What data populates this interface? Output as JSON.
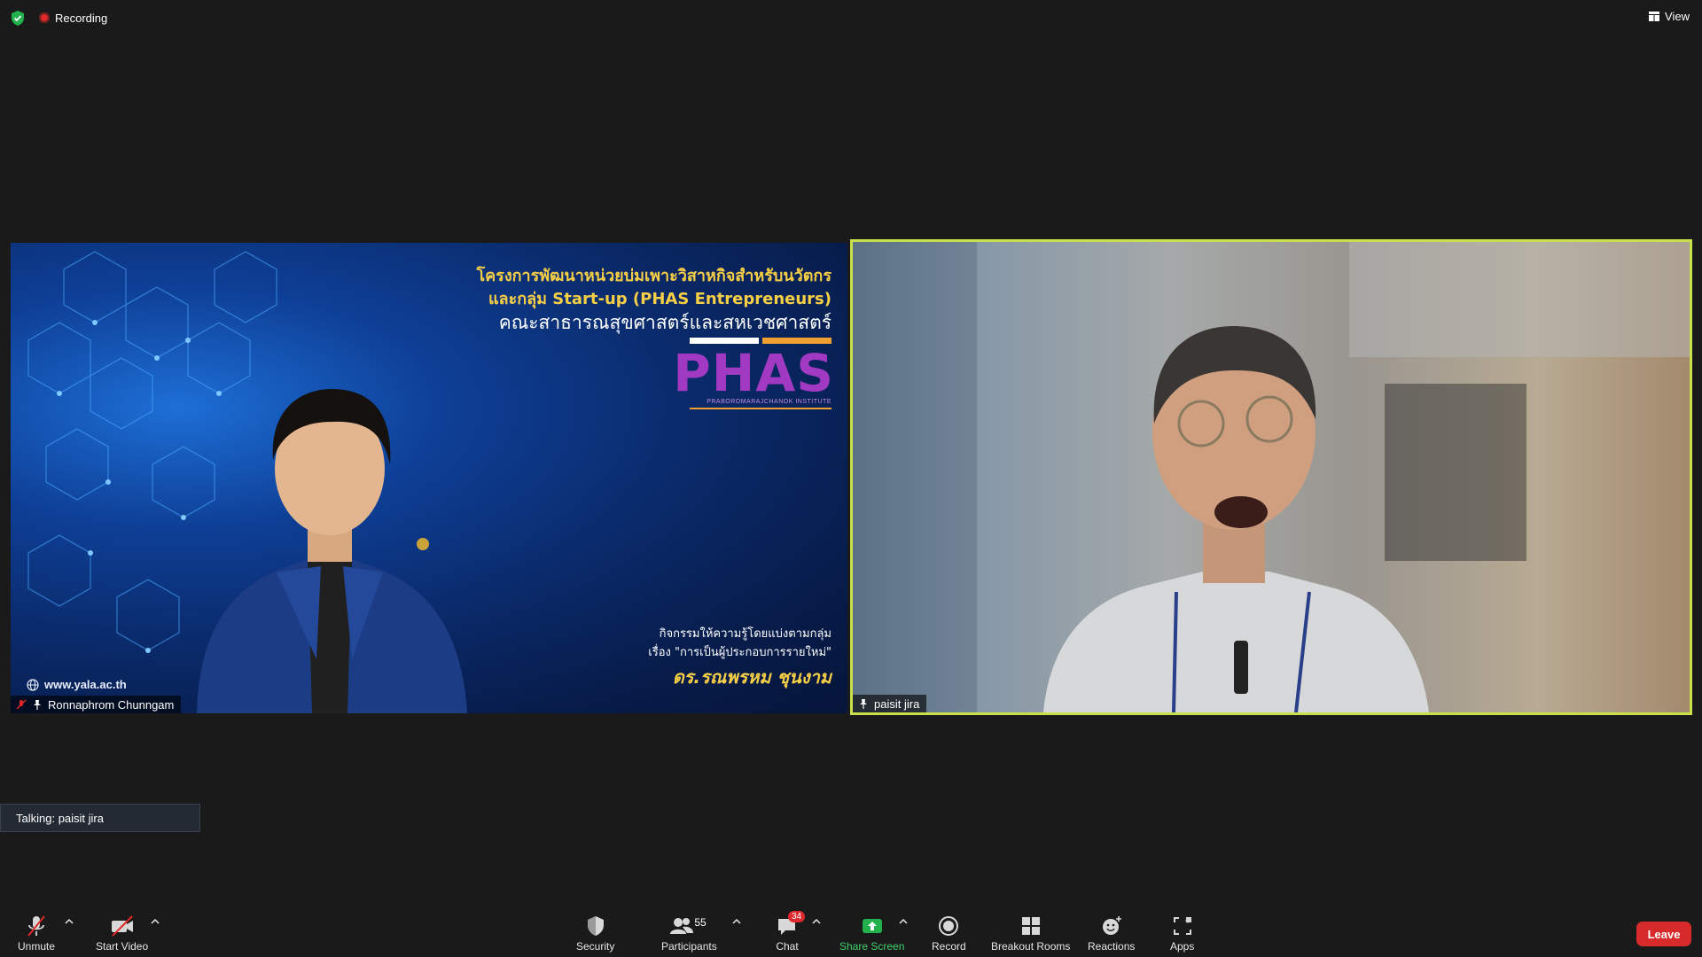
{
  "topbar": {
    "recording_label": "Recording",
    "view_label": "View"
  },
  "colors": {
    "active_speaker_border": "#c9e04a",
    "leave_button": "#d72b2b",
    "share_screen_green": "#22b14c",
    "recording_red": "#e02828"
  },
  "participants": [
    {
      "name": "Ronnaphrom Chunngam"
    },
    {
      "name": "paisit jira"
    }
  ],
  "slide": {
    "title_line1": "โครงการพัฒนาหน่วยบ่มเพาะวิสาหกิจสำหรับนวัตกร",
    "title_line2": "และกลุ่ม Start-up (PHAS Entrepreneurs)",
    "title_line3": "คณะสาธารณสุขศาสตร์และสหเวชศาสตร์",
    "logo": "PHAS",
    "logo_sub": "PRABOROMARAJCHANOK INSTITUTE",
    "activity_line1": "กิจกรรมให้ความรู้โดยแบ่งตามกลุ่ม",
    "activity_line2": "เรื่อง \"การเป็นผู้ประกอบการรายใหม่\"",
    "speaker": "ดร.รณพรหม ชุนงาม",
    "website": "www.yala.ac.th"
  },
  "talking": "Talking: paisit jira",
  "toolbar": {
    "unmute": "Unmute",
    "start_video": "Start Video",
    "security": "Security",
    "participants": "Participants",
    "participants_count": "55",
    "chat": "Chat",
    "chat_badge": "34",
    "share_screen": "Share Screen",
    "record": "Record",
    "breakout_rooms": "Breakout Rooms",
    "reactions": "Reactions",
    "apps": "Apps",
    "leave": "Leave"
  }
}
